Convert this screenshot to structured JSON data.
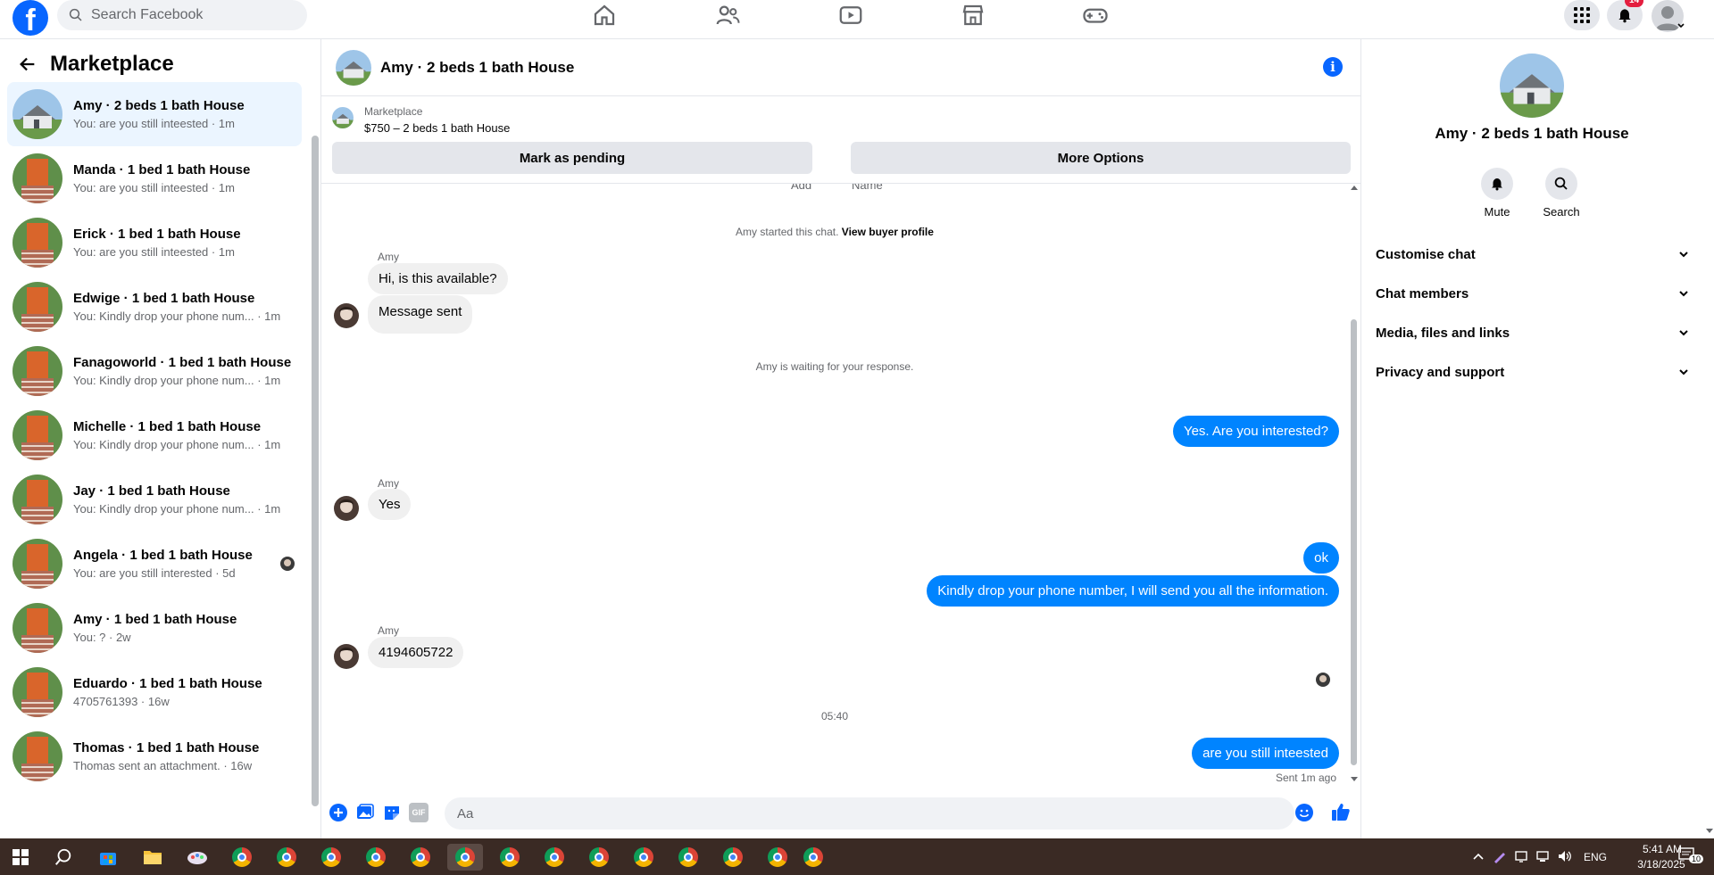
{
  "topnav": {
    "search_placeholder": "Search Facebook",
    "notifications_badge": "14"
  },
  "sidebar": {
    "title": "Marketplace",
    "conversations": [
      {
        "title": "Amy · 2 beds 1 bath House",
        "sub": "You: are you still inteested · 1m"
      },
      {
        "title": "Manda · 1 bed 1 bath House",
        "sub": "You: are you still inteested · 1m"
      },
      {
        "title": "Erick · 1 bed 1 bath House",
        "sub": "You: are you still inteested · 1m"
      },
      {
        "title": "Edwige · 1 bed 1 bath House",
        "sub": "You: Kindly drop your phone num... · 1m"
      },
      {
        "title": "Fanagoworld · 1 bed 1 bath House",
        "sub": "You: Kindly drop your phone num... · 1m"
      },
      {
        "title": "Michelle · 1 bed 1 bath House",
        "sub": "You: Kindly drop your phone num... · 1m"
      },
      {
        "title": "Jay · 1 bed 1 bath House",
        "sub": "You: Kindly drop your phone num... · 1m"
      },
      {
        "title": "Angela · 1 bed 1 bath House",
        "sub": "You: are you still interested · 5d"
      },
      {
        "title": "Amy · 1 bed 1 bath House",
        "sub": "You: ? · 2w"
      },
      {
        "title": "Eduardo · 1 bed 1 bath House",
        "sub": "4705761393 · 16w"
      },
      {
        "title": "Thomas · 1 bed 1 bath House",
        "sub": "Thomas sent an attachment. · 16w"
      }
    ]
  },
  "chat": {
    "header_name": "Amy · 2 beds 1 bath House",
    "info_glyph": "i",
    "listing_label": "Marketplace",
    "listing_price": "$750 – 2 beds 1 bath House",
    "mark_pending": "Mark as pending",
    "more_options": "More Options",
    "cut_left": "Add",
    "cut_right": "Name",
    "started_text": "Amy started this chat.",
    "view_buyer": "View buyer profile",
    "sender_name": "Amy",
    "msg_available": "Hi, is this available?",
    "msg_sent": "Message sent",
    "waiting": "Amy is waiting for your response.",
    "msg_interested": "Yes. Are you interested?",
    "msg_yes": "Yes",
    "msg_ok": "ok",
    "msg_kindly": "Kindly drop your phone number, I will send you all the information.",
    "msg_phone": "4194605722",
    "time_divider": "05:40",
    "msg_still": "are you still inteested",
    "sent_note": "Sent 1m ago",
    "composer_placeholder": "Aa",
    "gif_label": "GIF"
  },
  "details": {
    "name": "Amy · 2 beds 1 bath House",
    "mute": "Mute",
    "search": "Search",
    "sections": [
      "Customise chat",
      "Chat members",
      "Media, files and links",
      "Privacy and support"
    ]
  },
  "taskbar": {
    "lang": "ENG",
    "time": "5:41 AM",
    "date": "3/18/2025",
    "notif_count": "10"
  },
  "colors": {
    "brand_blue": "#0866ff",
    "outgoing_bubble": "#0084ff",
    "active_conversation": "#ebf5ff",
    "badge_red": "#e41e3f",
    "taskbar": "#3a2a24"
  }
}
